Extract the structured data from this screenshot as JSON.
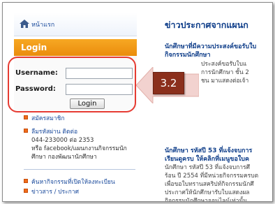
{
  "nav": {
    "home_label": "หน้าแรก"
  },
  "login": {
    "title": "Login",
    "username_label": "Username:",
    "password_label": "Password:",
    "username_value": "",
    "password_value": "",
    "button_label": "Login"
  },
  "links": {
    "register": "สมัครสมาชิก",
    "forgot": "ลืมรหัสผ่าน ติดต่อ",
    "phone": "044-233000 ต่อ 2353",
    "facebook": "หรือ facebook/แผนกงานกิจกรรมนัก",
    "dept": "ศึกษา กองพัฒนานักศึกษา",
    "search_activity": "ค้นหากิจกรรมที่เปิดให้ลงทะเบียน",
    "news": "ข่าวสาร / ประกาศ"
  },
  "news": {
    "heading": "ข่าวประกาศจากแผนก",
    "item1_title_1": "นักศึกษาที่มีความประสงค์ขอรับใบ",
    "item1_title_2": "กิจกรรมนักศึกษา",
    "item1_lines": [
      "ประสงค์ขอรับใบแ",
      "การนักศึกษา ชั้น 2",
      "ชน มาแสดงต่อเจ้า"
    ],
    "item2_title_1": "นักศึกษา รหัสปี 53 ที่แจ้งจบการ",
    "item2_title_2": "เรียนดูครบ ให้คลิกที่เมนูขอใบค",
    "item2_lines": [
      "นักศึกษา รหัสปี 53 ที่แจ้งจบการศึ",
      "ร้อน ปี 2554 ที่มีหน่วยกิจกรรมครบต",
      "เพื่อขอใบทรานสคริปท์กิจกรรมนักศึ",
      "ประกาศให้นักศึกษารับใบแสดงผล",
      "กิจกรรมนักศึกษาออนไลน์เท่านั้น ..."
    ]
  },
  "callout": {
    "step": "3.2"
  },
  "colors": {
    "accent_orange": "#F39C1A",
    "highlight_red": "#E63B32",
    "callout_brown": "#8B2F1C",
    "link_blue": "#1A4A9C"
  }
}
